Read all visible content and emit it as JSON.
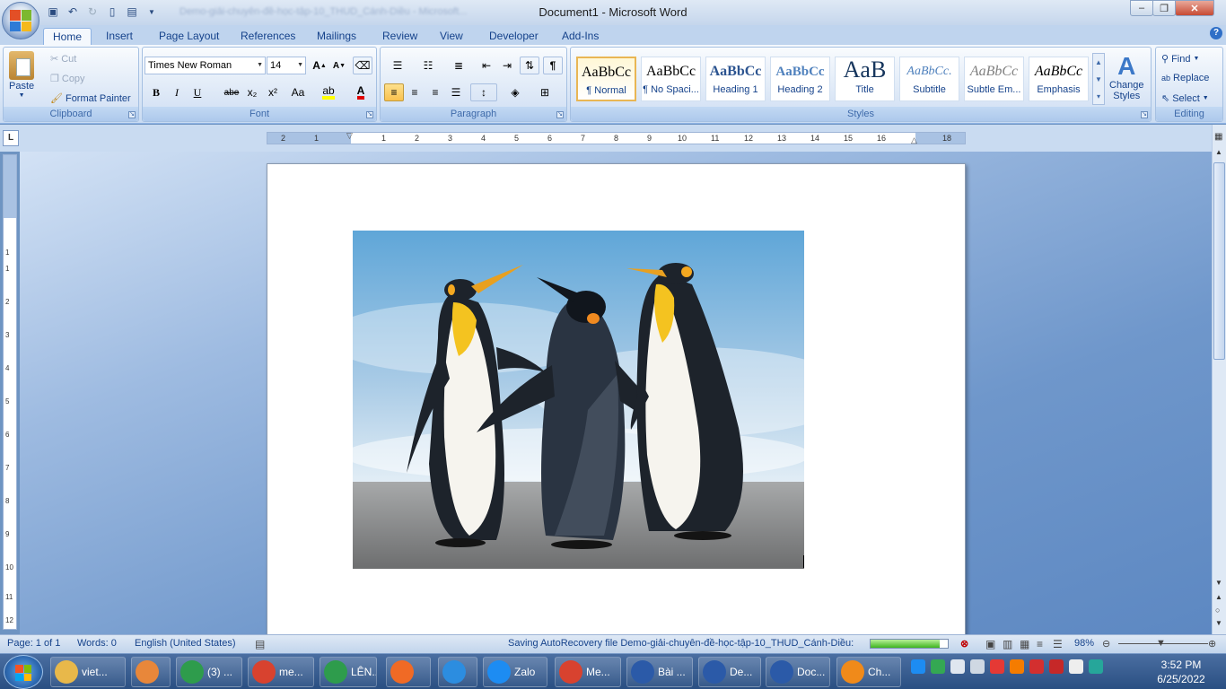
{
  "window": {
    "title": "Document1 - Microsoft Word",
    "blurred_title": "Demo-giải-chuyên-đề-học-tập-10_THUD_Cánh-Diều - Microsoft..."
  },
  "tabs": [
    "Home",
    "Insert",
    "Page Layout",
    "References",
    "Mailings",
    "Review",
    "View",
    "Developer",
    "Add-Ins"
  ],
  "clipboard": {
    "label": "Clipboard",
    "paste": "Paste",
    "cut": "Cut",
    "copy": "Copy",
    "format_painter": "Format Painter"
  },
  "font": {
    "label": "Font",
    "name": "Times New Roman",
    "size": "14",
    "bold": "B",
    "italic": "I",
    "underline": "U",
    "strike": "abe",
    "sub": "x₂",
    "sup": "x²",
    "case": "Aa"
  },
  "paragraph": {
    "label": "Paragraph"
  },
  "styles": {
    "label": "Styles",
    "items": [
      {
        "preview": "AaBbCc",
        "name": "¶ Normal"
      },
      {
        "preview": "AaBbCc",
        "name": "¶ No Spaci..."
      },
      {
        "preview": "AaBbCc",
        "name": "Heading 1"
      },
      {
        "preview": "AaBbCc",
        "name": "Heading 2"
      },
      {
        "preview": "AaB",
        "name": "Title"
      },
      {
        "preview": "AaBbCc.",
        "name": "Subtitle"
      },
      {
        "preview": "AaBbCc",
        "name": "Subtle Em..."
      },
      {
        "preview": "AaBbCc",
        "name": "Emphasis"
      }
    ],
    "change_line1": "Change",
    "change_line2": "Styles"
  },
  "editing": {
    "label": "Editing",
    "find": "Find",
    "replace": "Replace",
    "select": "Select"
  },
  "ruler": {
    "corner": "L",
    "h_ticks": [
      "2",
      "1",
      "1",
      "2",
      "3",
      "4",
      "5",
      "6",
      "7",
      "8",
      "9",
      "10",
      "11",
      "12",
      "13",
      "14",
      "15",
      "16",
      "18"
    ],
    "v_ticks": [
      "1",
      "1",
      "2",
      "3",
      "4",
      "5",
      "6",
      "7",
      "8",
      "9",
      "10",
      "11",
      "12"
    ]
  },
  "status": {
    "page": "Page: 1 of 1",
    "words": "Words: 0",
    "language": "English (United States)",
    "saving": "Saving AutoRecovery file Demo-giải-chuyên-đề-học-tập-10_THUD_Cánh-Diều:",
    "progress": 0.9,
    "zoom": "98%"
  },
  "taskbar": {
    "items": [
      {
        "label": "viet...",
        "color": "#e8b84a"
      },
      {
        "label": "",
        "color": "#e8873a"
      },
      {
        "label": "(3) ...",
        "color": "#2e9c4c"
      },
      {
        "label": "me...",
        "color": "#d8422f"
      },
      {
        "label": "LÊN...",
        "color": "#2e9c4c"
      },
      {
        "label": "",
        "color": "#f06a25"
      },
      {
        "label": "",
        "color": "#2c8de0"
      },
      {
        "label": "Zalo",
        "color": "#1d8cf2"
      },
      {
        "label": "Me...",
        "color": "#d8422f"
      },
      {
        "label": "Bài ...",
        "color": "#2b5aa8"
      },
      {
        "label": "De...",
        "color": "#2b5aa8"
      },
      {
        "label": "Doc...",
        "color": "#2b5aa8"
      },
      {
        "label": "Ch...",
        "color": "#f08a1a"
      }
    ],
    "time": "3:52 PM",
    "date": "6/25/2022"
  }
}
